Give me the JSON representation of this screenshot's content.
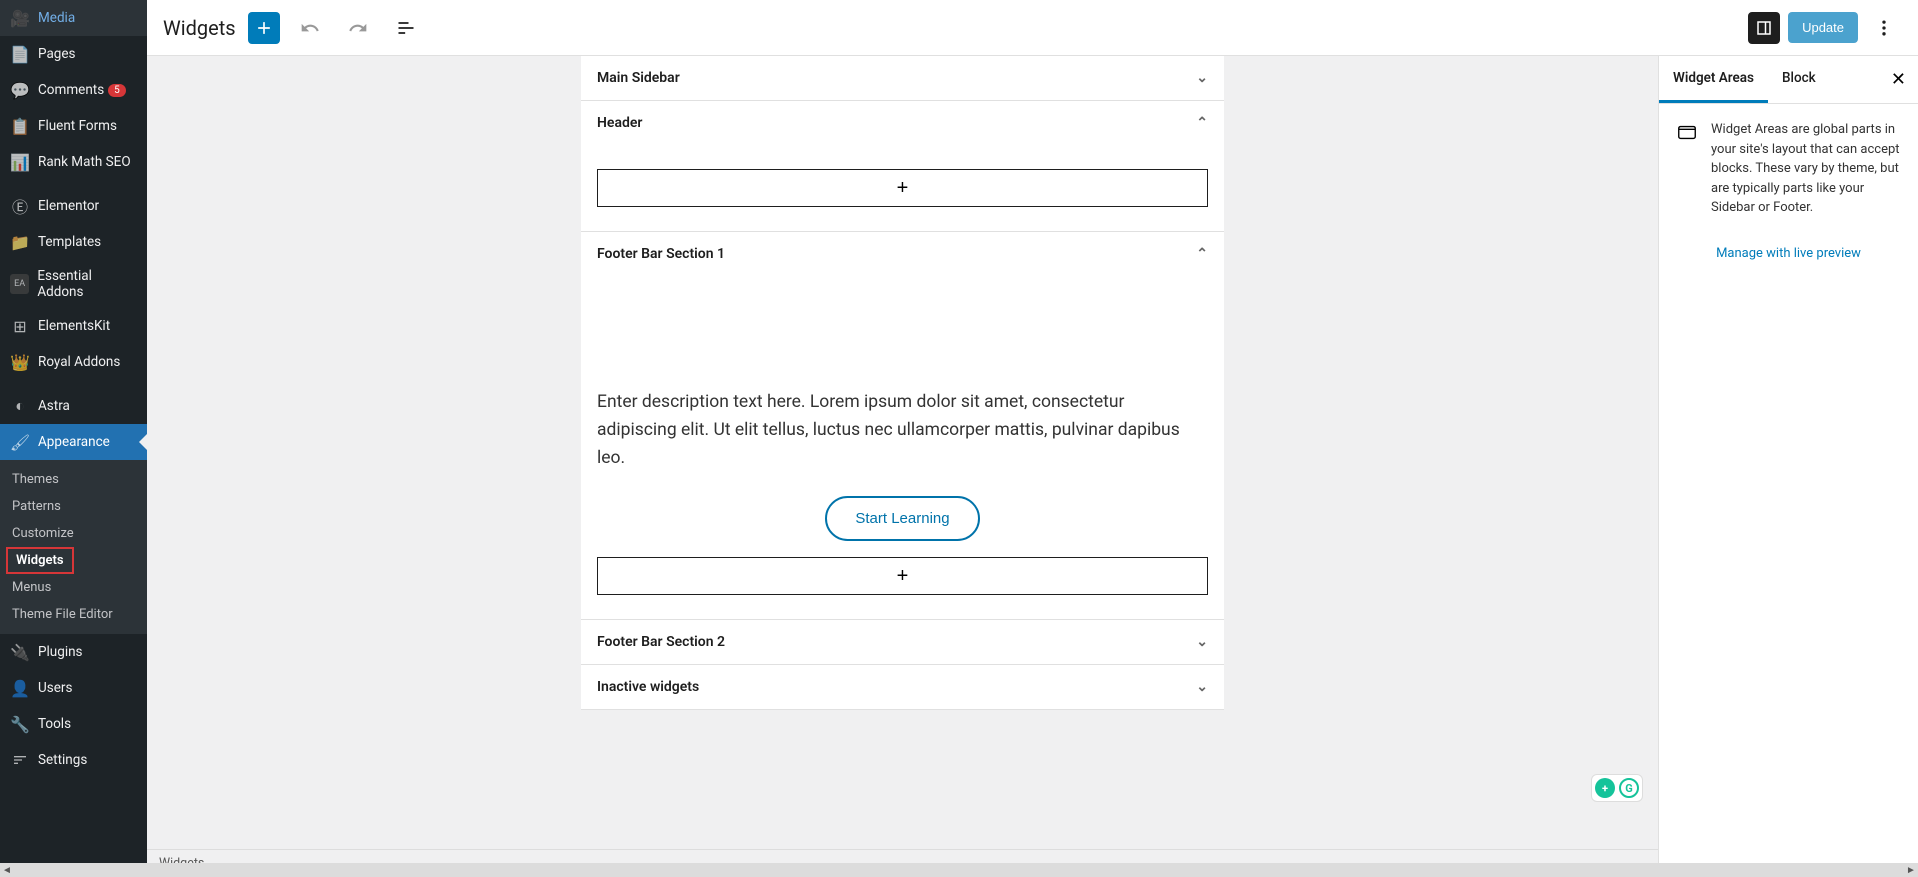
{
  "sidebar": {
    "items": [
      {
        "label": "Media",
        "icon": "🖼"
      },
      {
        "label": "Pages",
        "icon": "📄"
      },
      {
        "label": "Comments",
        "icon": "💬",
        "badge": "5"
      },
      {
        "label": "Fluent Forms",
        "icon": "📋"
      },
      {
        "label": "Rank Math SEO",
        "icon": "📊"
      },
      {
        "label": "Elementor",
        "icon": "Ⓔ"
      },
      {
        "label": "Templates",
        "icon": "📁"
      },
      {
        "label": "Essential Addons",
        "icon": "EA"
      },
      {
        "label": "ElementsKit",
        "icon": "⊞"
      },
      {
        "label": "Royal Addons",
        "icon": "👑"
      },
      {
        "label": "Astra",
        "icon": "◐"
      },
      {
        "label": "Appearance",
        "icon": "🖌"
      },
      {
        "label": "Plugins",
        "icon": "🔌"
      },
      {
        "label": "Users",
        "icon": "👤"
      },
      {
        "label": "Tools",
        "icon": "🔧"
      },
      {
        "label": "Settings",
        "icon": "⚙"
      }
    ],
    "sub": {
      "themes": "Themes",
      "patterns": "Patterns",
      "customize": "Customize",
      "widgets": "Widgets",
      "menus": "Menus",
      "editor": "Theme File Editor"
    }
  },
  "toolbar": {
    "title": "Widgets",
    "update": "Update"
  },
  "panels": {
    "mainSidebar": "Main Sidebar",
    "header": "Header",
    "footer1": "Footer Bar Section 1",
    "footer1_desc": "Enter description text here. Lorem ipsum dolor sit amet, consectetur adipiscing elit. Ut elit tellus, luctus nec ullamcorper mattis, pulvinar dapibus leo.",
    "footer1_btn": "Start Learning",
    "footer2": "Footer Bar Section 2",
    "inactive": "Inactive widgets"
  },
  "rightPanel": {
    "tab1": "Widget Areas",
    "tab2": "Block",
    "desc": "Widget Areas are global parts in your site's layout that can accept blocks. These vary by theme, but are typically parts like your Sidebar or Footer.",
    "link": "Manage with live preview"
  },
  "footer": {
    "breadcrumb": "Widgets"
  }
}
